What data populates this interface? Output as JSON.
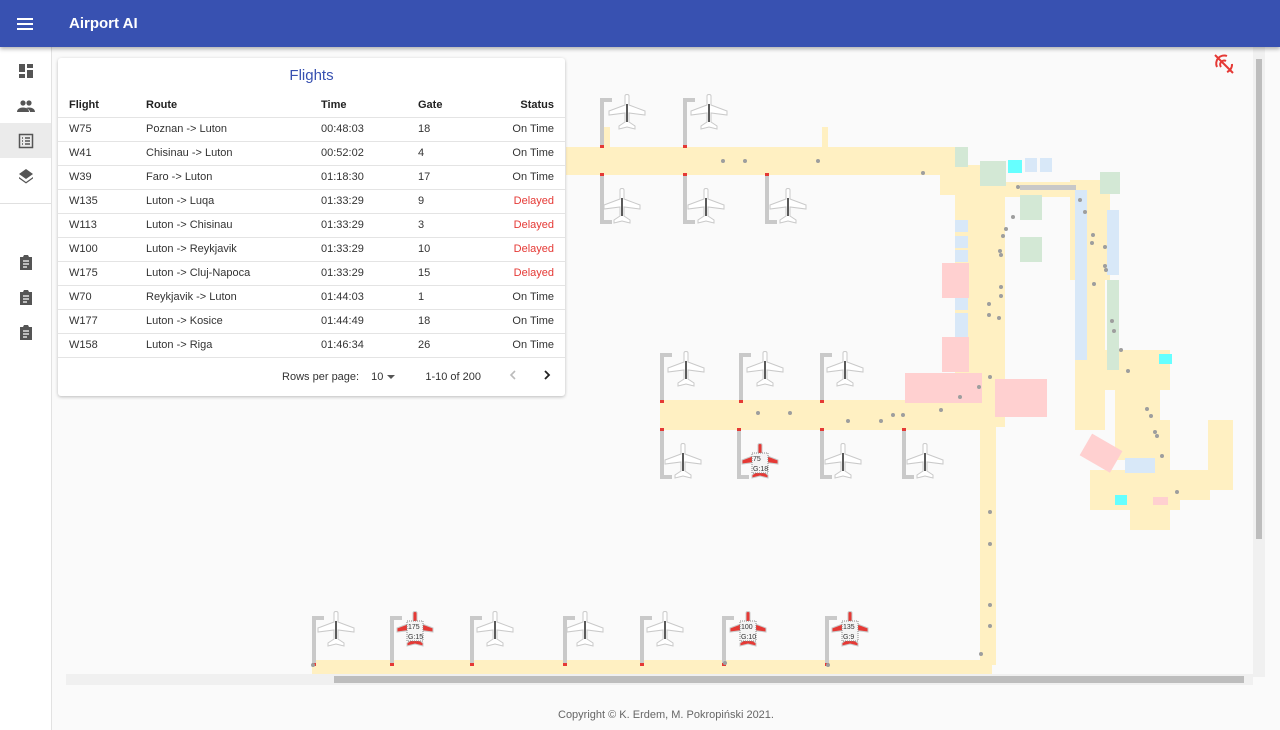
{
  "app": {
    "title": "Airport AI",
    "menu_icon": "menu-icon"
  },
  "sidebar": {
    "items": [
      {
        "icon": "dashboard-icon"
      },
      {
        "icon": "people-icon"
      },
      {
        "icon": "list-icon",
        "active": true
      },
      {
        "icon": "layers-icon"
      },
      {
        "icon": "clipboard-icon"
      },
      {
        "icon": "clipboard-icon"
      },
      {
        "icon": "clipboard-icon"
      }
    ]
  },
  "flights": {
    "title": "Flights",
    "columns": [
      "Flight",
      "Route",
      "Time",
      "Gate",
      "Status"
    ],
    "rows": [
      [
        "W75",
        "Poznan -> Luton",
        "00:48:03",
        "18",
        "On Time"
      ],
      [
        "W41",
        "Chisinau -> Luton",
        "00:52:02",
        "4",
        "On Time"
      ],
      [
        "W39",
        "Faro -> Luton",
        "01:18:30",
        "17",
        "On Time"
      ],
      [
        "W135",
        "Luton -> Luqa",
        "01:33:29",
        "9",
        "Delayed"
      ],
      [
        "W113",
        "Luton -> Chisinau",
        "01:33:29",
        "3",
        "Delayed"
      ],
      [
        "W100",
        "Luton -> Reykjavik",
        "01:33:29",
        "10",
        "Delayed"
      ],
      [
        "W175",
        "Luton -> Cluj-Napoca",
        "01:33:29",
        "15",
        "Delayed"
      ],
      [
        "W70",
        "Reykjavik -> Luton",
        "01:44:03",
        "1",
        "On Time"
      ],
      [
        "W177",
        "Luton -> Kosice",
        "01:44:49",
        "18",
        "On Time"
      ],
      [
        "W158",
        "Luton -> Riga",
        "01:46:34",
        "26",
        "On Time"
      ]
    ],
    "pagination": {
      "rows_per_page_label": "Rows per page:",
      "rows_per_page": "10",
      "range": "1-10 of 200"
    }
  },
  "map": {
    "status_icon": "signal-off-icon",
    "colors": {
      "corridor": "#fff0c2",
      "shop": "#ffd0d0",
      "service": "#d3e8d5",
      "gate_room": "#d8e8f8",
      "elevator": "#66ffff",
      "alert": "#e53935"
    },
    "active_planes": [
      {
        "flight": "75",
        "gate": "G:18"
      },
      {
        "flight": "175",
        "gate": "G:15"
      },
      {
        "flight": "100",
        "gate": "G:10"
      },
      {
        "flight": "135",
        "gate": "G:9"
      }
    ]
  },
  "footer": {
    "copyright": "Copyright © K. Erdem, M. Pokropiński 2021."
  }
}
